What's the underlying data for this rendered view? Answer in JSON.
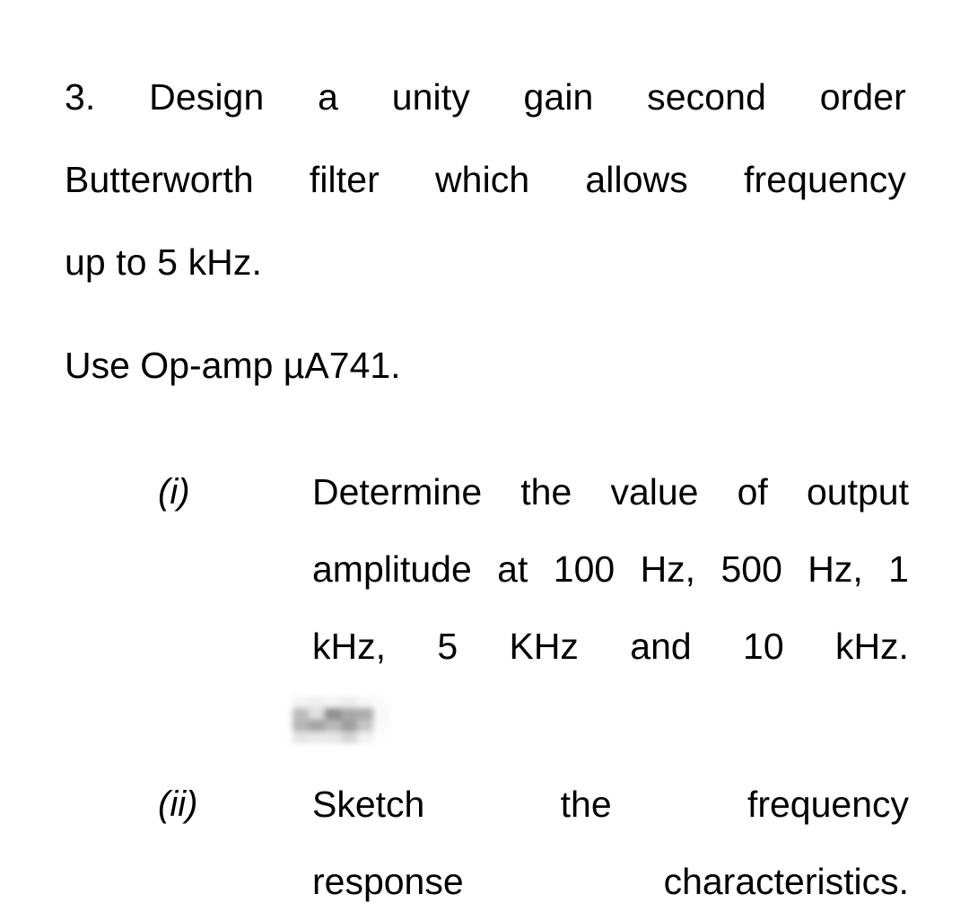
{
  "document": {
    "background_color": "#ffffff",
    "text_color": "#000000",
    "question_number": "3.",
    "stem": {
      "line1_words": [
        "3.",
        "Design",
        "a",
        "unity",
        "gain",
        "second",
        "order"
      ],
      "line2_words": [
        "Butterworth",
        "filter",
        "which",
        "allows",
        "frequency"
      ],
      "line3": "up to 5 kHz.",
      "line4": "Use Op-amp µA741."
    },
    "subitems": [
      {
        "marker": "(i)",
        "lines": [
          {
            "words": [
              "Determine",
              "the",
              "value",
              "of",
              "output"
            ],
            "justified": true
          },
          {
            "words": [
              "amplitude",
              "at",
              "100",
              "Hz,",
              "500",
              "Hz,",
              "1"
            ],
            "justified": true
          },
          {
            "words": [
              "kHz,",
              "5",
              "KHz",
              "and",
              "10",
              "kHz."
            ],
            "justified": true
          }
        ]
      },
      {
        "marker": "(ii)",
        "lines": [
          {
            "words": [
              "Sketch",
              "the",
              "frequency"
            ],
            "justified": true
          },
          {
            "words": [
              "response",
              "characteristics."
            ],
            "justified": true
          }
        ]
      }
    ],
    "redaction": {
      "label": "redacted-blurred-text",
      "tiles": [
        "#f2f2f2",
        "#efefef",
        "#f4f4f4",
        "#ececec",
        "#f6f6f6",
        "#fbfbfb",
        "#bdbdbd",
        "#dedede",
        "#8f8f8f",
        "#a8a8a8",
        "#acacac",
        "#f7f7f7",
        "#b6b6b6",
        "#a3a3a3",
        "#b9b9b9",
        "#a0a0a0",
        "#c6c6c6",
        "#fafafa",
        "#e4e4e4",
        "#eaeaea",
        "#e7e7e7",
        "#d5d5d5",
        "#f1f1f1",
        "#fdfdfd"
      ]
    }
  }
}
